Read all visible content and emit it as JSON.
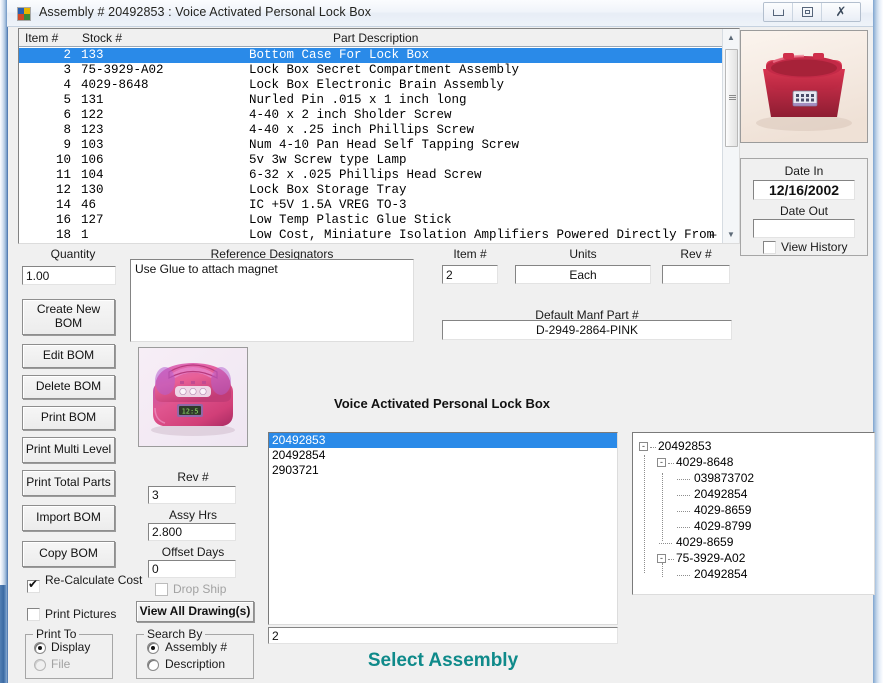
{
  "window": {
    "title": "Assembly # 20492853 : Voice Activated Personal  Lock Box",
    "icon": "app-icon",
    "minimize_label": "–",
    "maximize_label": "□",
    "close_label": "✗"
  },
  "parts_list": {
    "columns": [
      "Item #",
      "Stock #",
      "Part Description"
    ],
    "rows": [
      {
        "item": "2",
        "stock": "133",
        "desc": "Bottom Case For Lock Box",
        "selected": true
      },
      {
        "item": "3",
        "stock": "75-3929-A02",
        "desc": "Lock Box Secret Compartment Assembly"
      },
      {
        "item": "4",
        "stock": "4029-8648",
        "desc": "Lock Box Electronic Brain Assembly"
      },
      {
        "item": "5",
        "stock": "131",
        "desc": "Nurled Pin .015 x 1 inch long"
      },
      {
        "item": "6",
        "stock": "122",
        "desc": "4-40 x 2 inch Sholder Screw"
      },
      {
        "item": "8",
        "stock": "123",
        "desc": "4-40 x .25 inch Phillips Screw"
      },
      {
        "item": "9",
        "stock": "103",
        "desc": "Num 4-10  Pan Head Self Tapping Screw"
      },
      {
        "item": "10",
        "stock": "106",
        "desc": "5v 3w Screw type Lamp"
      },
      {
        "item": "11",
        "stock": "104",
        "desc": "6-32 x .025 Phillips Head Screw"
      },
      {
        "item": "12",
        "stock": "130",
        "desc": "Lock Box Storage Tray"
      },
      {
        "item": "14",
        "stock": "46",
        "desc": "IC +5V 1.5A VREG TO-3"
      },
      {
        "item": "16",
        "stock": "127",
        "desc": "Low Temp Plastic Glue Stick"
      },
      {
        "item": "18",
        "stock": "1",
        "desc": "Low Cost, Miniature Isolation Amplifiers Powered Directly From a +"
      }
    ],
    "scroll_plus": "+"
  },
  "date_panel": {
    "date_in_label": "Date In",
    "date_in_value": "12/16/2002",
    "date_out_label": "Date Out",
    "date_out_value": "",
    "view_history_label": "View History",
    "view_history_checked": false
  },
  "detail": {
    "quantity_label": "Quantity",
    "quantity_value": "1.00",
    "refdes_label": "Reference Designators",
    "refdes_value": "Use Glue to attach magnet",
    "item_label": "Item #",
    "item_value": "2",
    "units_label": "Units",
    "units_value": "Each",
    "rev_label": "Rev #",
    "rev_value": "",
    "manf_label": "Default Manf Part #",
    "manf_value": "D-2949-2864-PINK"
  },
  "actions": {
    "buttons": [
      "Create New BOM",
      "Edit BOM",
      "Delete BOM",
      "Print BOM",
      "Print Multi Level",
      "Print Total Parts",
      "Import BOM",
      "Copy BOM"
    ],
    "recalculate_label": "Re-Calculate Cost",
    "recalculate_checked": true,
    "print_pictures_label": "Print Pictures",
    "print_pictures_checked": false,
    "print_to_label": "Print To",
    "print_to_display": "Display",
    "print_to_file": "File",
    "print_to_selected": "Display"
  },
  "assembly_fields": {
    "rev_label": "Rev #",
    "rev_value": "3",
    "assy_hrs_label": "Assy Hrs",
    "assy_hrs_value": "2.800",
    "offset_days_label": "Offset Days",
    "offset_days_value": "0",
    "drop_ship_label": "Drop Ship",
    "drop_ship_checked": false,
    "view_drawings_label": "View All Drawing(s)",
    "search_by_label": "Search By",
    "search_by_assembly": "Assembly #",
    "search_by_description": "Description",
    "search_by_selected": "Assembly #"
  },
  "assembly_panel": {
    "title": "Voice Activated Personal  Lock Box",
    "items": [
      {
        "id": "20492853",
        "selected": true
      },
      {
        "id": "20492854"
      },
      {
        "id": "2903721"
      }
    ],
    "search_value": "2",
    "footer_label": "Select Assembly",
    "footer_color": "#0f8a8a"
  },
  "tree": {
    "nodes": [
      {
        "label": "20492853",
        "depth": 0,
        "expander": "-"
      },
      {
        "label": "4029-8648",
        "depth": 1,
        "expander": "-"
      },
      {
        "label": "039873702",
        "depth": 2,
        "expander": ""
      },
      {
        "label": "20492854",
        "depth": 2,
        "expander": ""
      },
      {
        "label": "4029-8659",
        "depth": 2,
        "expander": ""
      },
      {
        "label": "4029-8799",
        "depth": 2,
        "expander": ""
      },
      {
        "label": "4029-8659",
        "depth": 1,
        "expander": ""
      },
      {
        "label": "75-3929-A02",
        "depth": 1,
        "expander": "-"
      },
      {
        "label": "20492854",
        "depth": 2,
        "expander": ""
      }
    ]
  },
  "pictures": {
    "top_right_alt": "red-lock-box-bottom-case-photo",
    "left_alt": "pink-voice-activated-lock-box-photo"
  }
}
